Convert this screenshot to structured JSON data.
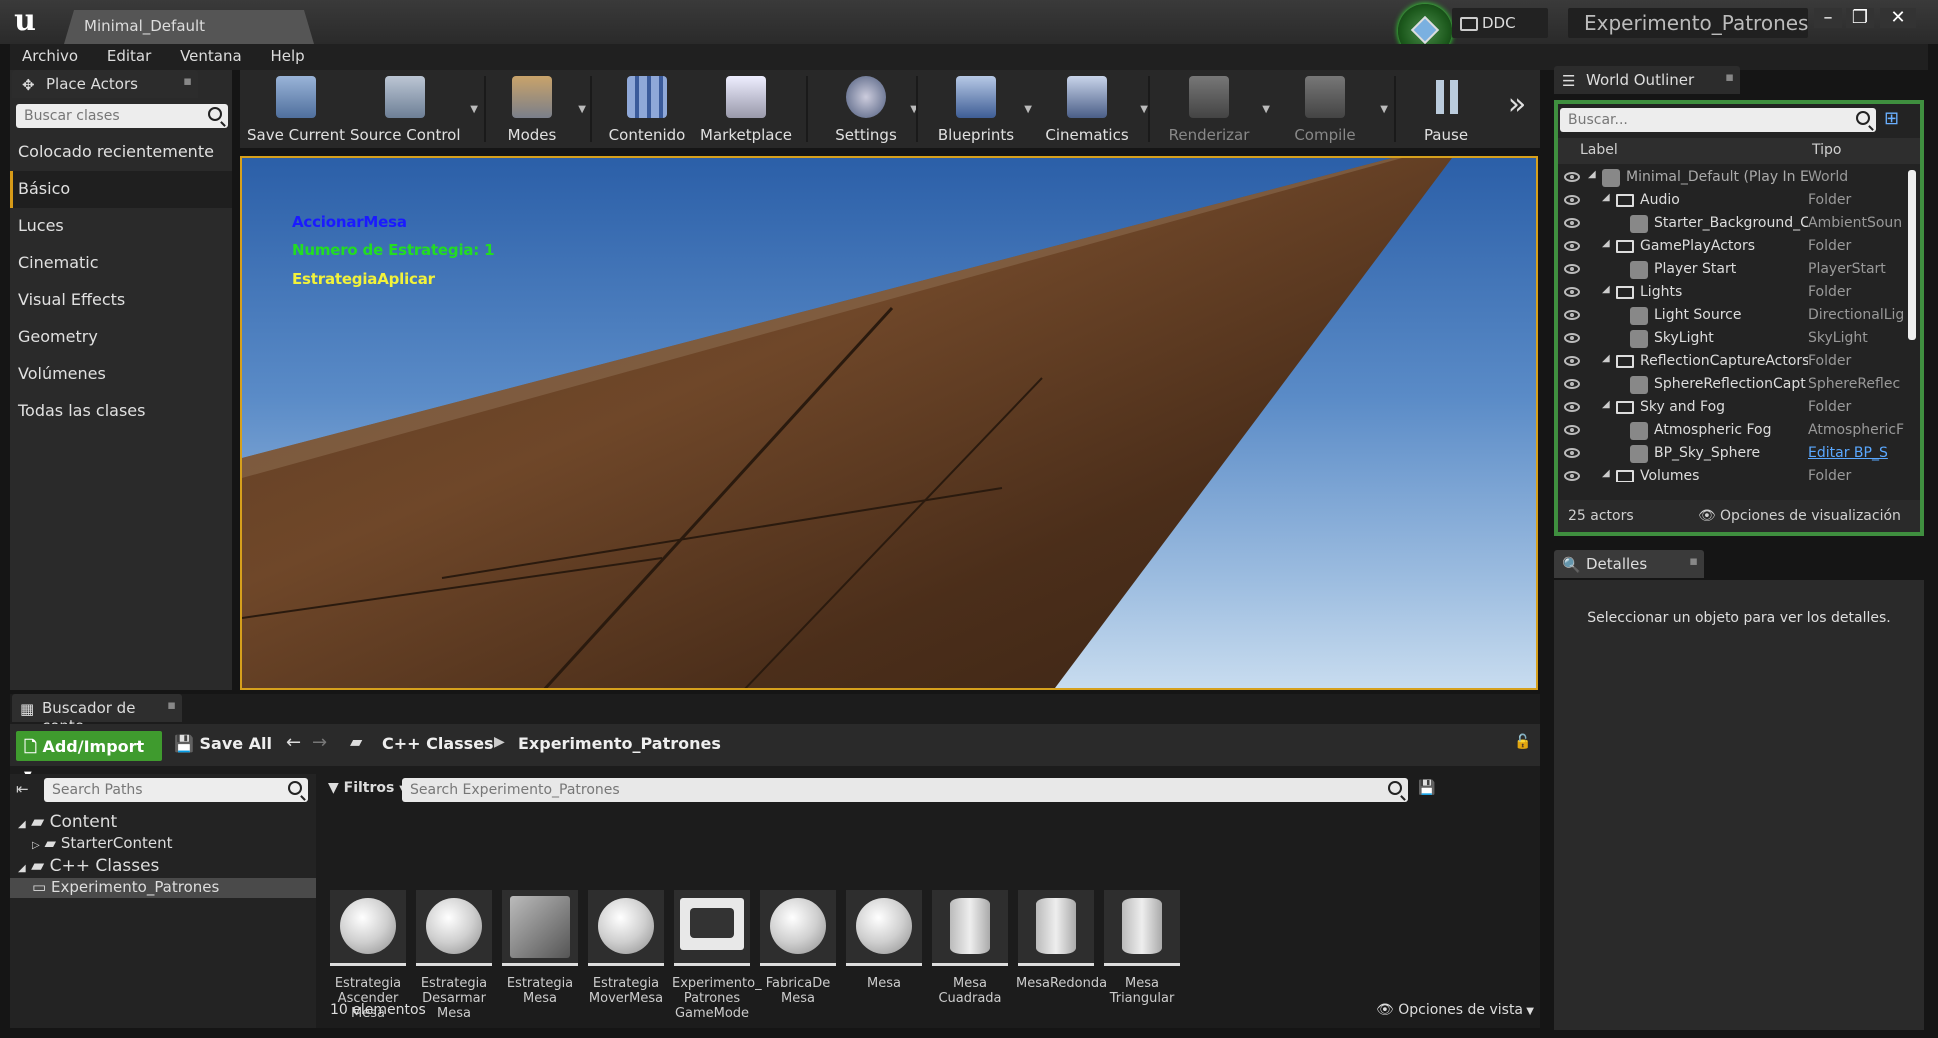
{
  "title_bar": {
    "level_tab": "Minimal_Default",
    "ddc_label": "DDC",
    "window_title": "Experimento_Patrones"
  },
  "menu": [
    "Archivo",
    "Editar",
    "Ventana",
    "Help"
  ],
  "place_actors": {
    "tab": "Place Actors",
    "search_placeholder": "Buscar clases",
    "categories": [
      "Colocado recientemente",
      "Básico",
      "Luces",
      "Cinematic",
      "Visual Effects",
      "Geometry",
      "Volúmenes",
      "Todas las clases"
    ],
    "selected": "Básico"
  },
  "toolbar": {
    "save_current": "Save Current",
    "source_control": "Source Control",
    "modes": "Modes",
    "contenido": "Contenido",
    "marketplace": "Marketplace",
    "settings": "Settings",
    "blueprints": "Blueprints",
    "cinematics": "Cinematics",
    "renderizar": "Renderizar",
    "compile": "Compile",
    "pause": "Pause",
    "more": "»"
  },
  "viewport": {
    "line1": "AccionarMesa",
    "line2": "Numero de Estrategia: 1",
    "line3": "EstrategiaAplicar",
    "line1_color": "#1a1aff",
    "line2_color": "#22dd22",
    "line3_color": "#f2f23a"
  },
  "outliner": {
    "tab": "World Outliner",
    "search_placeholder": "Buscar...",
    "col_label": "Label",
    "col_type": "Tipo",
    "rows": [
      {
        "label": "Minimal_Default (Play In E",
        "type": "World",
        "level": 0,
        "folder": false
      },
      {
        "label": "Audio",
        "type": "Folder",
        "level": 1,
        "folder": true
      },
      {
        "label": "Starter_Background_C",
        "type": "AmbientSoun",
        "level": 2,
        "folder": false
      },
      {
        "label": "GamePlayActors",
        "type": "Folder",
        "level": 1,
        "folder": true
      },
      {
        "label": "Player Start",
        "type": "PlayerStart",
        "level": 2,
        "folder": false
      },
      {
        "label": "Lights",
        "type": "Folder",
        "level": 1,
        "folder": true
      },
      {
        "label": "Light Source",
        "type": "DirectionalLig",
        "level": 2,
        "folder": false
      },
      {
        "label": "SkyLight",
        "type": "SkyLight",
        "level": 2,
        "folder": false
      },
      {
        "label": "ReflectionCaptureActors",
        "type": "Folder",
        "level": 1,
        "folder": true
      },
      {
        "label": "SphereReflectionCapt",
        "type": "SphereReflec",
        "level": 2,
        "folder": false
      },
      {
        "label": "Sky and Fog",
        "type": "Folder",
        "level": 1,
        "folder": true
      },
      {
        "label": "Atmospheric Fog",
        "type": "AtmosphericF",
        "level": 2,
        "folder": false
      },
      {
        "label": "BP_Sky_Sphere",
        "type": "Editar BP_S",
        "level": 2,
        "folder": false
      },
      {
        "label": "Volumes",
        "type": "Folder",
        "level": 1,
        "folder": true
      }
    ],
    "actor_count": "25 actors",
    "view_options": "Opciones de visualización"
  },
  "details": {
    "tab": "Detalles",
    "empty_msg": "Seleccionar un objeto para ver los detalles."
  },
  "content_browser": {
    "tab": "Buscador de conte",
    "add_import": "Add/Import",
    "save_all": "Save All",
    "crumb1": "C++ Classes",
    "crumb2": "Experimento_Patrones",
    "search_paths_placeholder": "Search Paths",
    "filters": "Filtros",
    "search_assets_placeholder": "Search Experimento_Patrones",
    "tree": [
      "Content",
      "StarterContent",
      "C++ Classes",
      "Experimento_Patrones"
    ],
    "assets": [
      {
        "name": "Estrategia Ascender Mesa",
        "thumb": "sphere"
      },
      {
        "name": "Estrategia Desarmar Mesa",
        "thumb": "sphere"
      },
      {
        "name": "Estrategia Mesa",
        "thumb": "class"
      },
      {
        "name": "Estrategia MoverMesa",
        "thumb": "sphere"
      },
      {
        "name": "Experimento_ Patrones GameMode",
        "thumb": "gamemode"
      },
      {
        "name": "FabricaDe Mesa",
        "thumb": "sphere"
      },
      {
        "name": "Mesa",
        "thumb": "sphere"
      },
      {
        "name": "Mesa Cuadrada",
        "thumb": "cylinder"
      },
      {
        "name": "MesaRedonda",
        "thumb": "cylinder"
      },
      {
        "name": "Mesa Triangular",
        "thumb": "cylinder"
      }
    ],
    "item_count": "10 elementos",
    "view_options": "Opciones de vista"
  }
}
